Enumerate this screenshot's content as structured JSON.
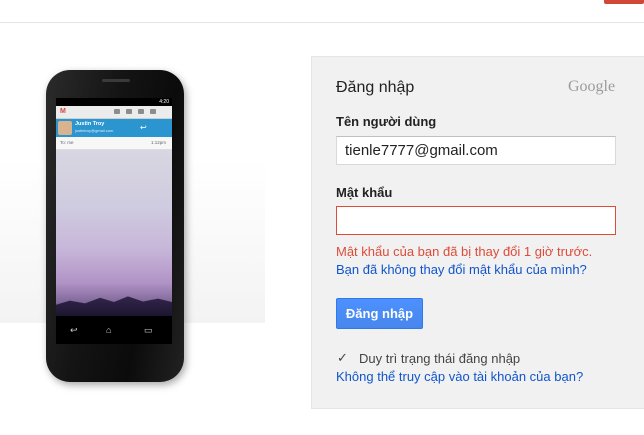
{
  "phone": {
    "status_time": "4:20",
    "sender_name": "Justin Troy",
    "sender_email": "justintroy@gmail.com",
    "to_label": "To: me",
    "mail_time": "1:12pm"
  },
  "login": {
    "title": "Đăng nhập",
    "logo": "Google",
    "username_label": "Tên người dùng",
    "username_value": "tienle7777@gmail.com",
    "password_label": "Mật khẩu",
    "password_value": "",
    "error_message": "Mật khẩu của bạn đã bị thay đổi 1 giờ trước.",
    "didnt_change_link": "Bạn đã không thay đổi mật khẩu của mình?",
    "signin_button": "Đăng nhập",
    "stay_signed_in": "Duy trì trạng thái đăng nhập",
    "stay_signed_in_checked": true,
    "cant_access_link": "Không thể truy cập vào tài khoản của bạn?"
  },
  "colors": {
    "error": "#dd4b39",
    "link": "#1155cc",
    "button": "#4d90fe"
  }
}
